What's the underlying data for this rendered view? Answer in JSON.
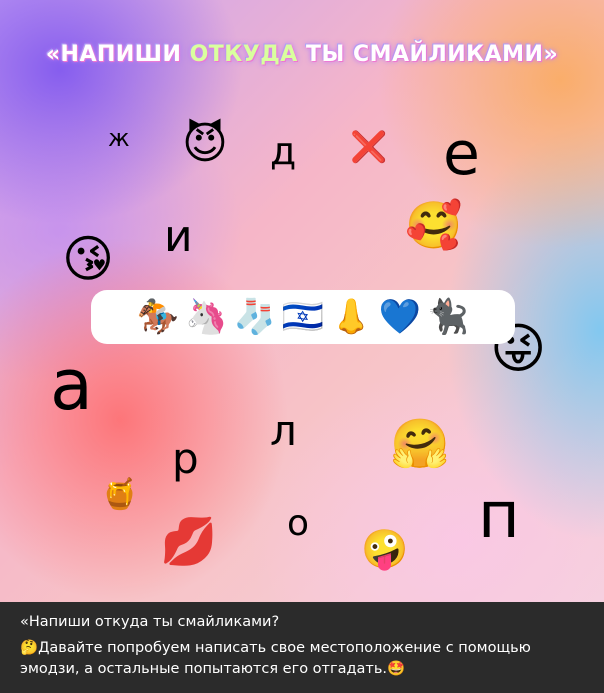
{
  "title": {
    "part1": "«НАПИШИ ",
    "part2": "ОТКУДА",
    "part3": " ТЫ СМАЙЛИКАМИ»"
  },
  "letters": [
    "ж",
    "д",
    "е",
    "и",
    "а",
    "л",
    "р",
    "о",
    "п"
  ],
  "emojis": {
    "devil": "😈",
    "cross": "❌",
    "hearts_face": "🥰",
    "kiss_face": "😘",
    "wink_tongue": "😜",
    "hug": "🤗",
    "honey": "🍯",
    "lips": "💋",
    "zany": "🤪"
  },
  "strip": [
    "🏇",
    "🦄",
    "🧦",
    "🇮🇱",
    "👃",
    "💙",
    "🐈‍⬛"
  ],
  "caption": {
    "title": "«Напиши откуда ты смайликами?",
    "body_icon": "🤔",
    "body": "Давайте попробуем написать свое местоположение с помощью эмодзи, а остальные попытаются его отгадать.",
    "end_icon": "🤩"
  },
  "colors": {
    "caption_bg": "#2b2b2b",
    "title_highlight": "#d9ff9e"
  }
}
